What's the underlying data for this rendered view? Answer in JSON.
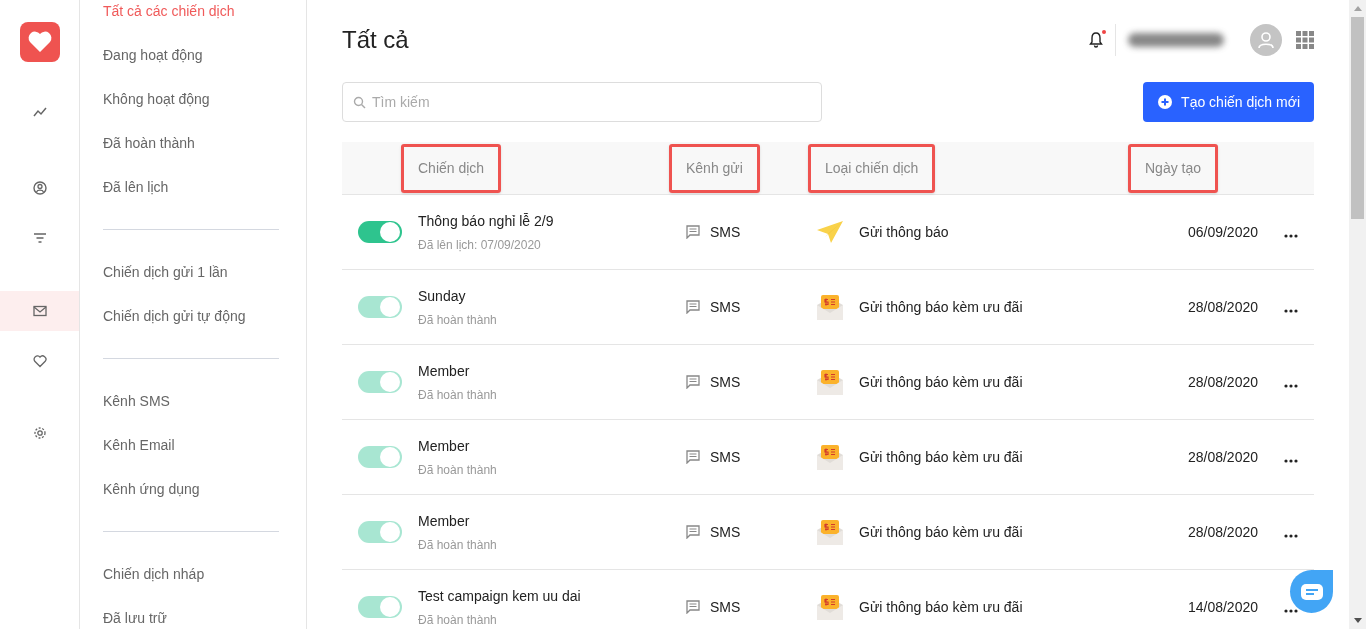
{
  "rail": {
    "items": [
      {
        "kind": "chart",
        "selected": false
      },
      {
        "kind": "user",
        "selected": false
      },
      {
        "kind": "filter",
        "selected": false
      },
      {
        "kind": "mail",
        "selected": true
      },
      {
        "kind": "heart",
        "selected": false
      },
      {
        "kind": "settings",
        "selected": false
      }
    ]
  },
  "sidebar": {
    "groups": [
      [
        {
          "label": "Tất cả các chiến dịch",
          "selected": true
        },
        {
          "label": "Đang hoạt động",
          "selected": false
        },
        {
          "label": "Không hoạt động",
          "selected": false
        },
        {
          "label": "Đã hoàn thành",
          "selected": false
        },
        {
          "label": "Đã lên lịch",
          "selected": false
        }
      ],
      [
        {
          "label": "Chiến dịch gửi 1 lần",
          "selected": false
        },
        {
          "label": "Chiến dịch gửi tự động",
          "selected": false
        }
      ],
      [
        {
          "label": "Kênh SMS",
          "selected": false
        },
        {
          "label": "Kênh Email",
          "selected": false
        },
        {
          "label": "Kênh ứng dụng",
          "selected": false
        }
      ],
      [
        {
          "label": "Chiến dịch nháp",
          "selected": false
        },
        {
          "label": "Đã lưu trữ",
          "selected": false
        }
      ]
    ]
  },
  "header": {
    "title": "Tất cả",
    "notification_dot": true
  },
  "search": {
    "placeholder": "Tìm kiếm"
  },
  "create_button": "Tạo chiến dịch mới",
  "table": {
    "columns": [
      {
        "label": "Chiến dịch",
        "highlighted": true
      },
      {
        "label": "Kênh gửi",
        "highlighted": true
      },
      {
        "label": "Loại chiến dịch",
        "highlighted": true
      },
      {
        "label": "Ngày tạo",
        "highlighted": true
      }
    ],
    "rows": [
      {
        "on": true,
        "disabled": false,
        "name": "Thông báo nghỉ lễ 2/9",
        "status": "Đã lên lịch: 07/09/2020",
        "channel": "SMS",
        "kind": "notice",
        "type": "Gửi thông báo",
        "date": "06/09/2020"
      },
      {
        "on": true,
        "disabled": true,
        "name": "Sunday",
        "status": "Đã hoàn thành",
        "channel": "SMS",
        "kind": "offer",
        "type": "Gửi thông báo kèm ưu đãi",
        "date": "28/08/2020"
      },
      {
        "on": true,
        "disabled": true,
        "name": "Member",
        "status": "Đã hoàn thành",
        "channel": "SMS",
        "kind": "offer",
        "type": "Gửi thông báo kèm ưu đãi",
        "date": "28/08/2020"
      },
      {
        "on": true,
        "disabled": true,
        "name": "Member",
        "status": "Đã hoàn thành",
        "channel": "SMS",
        "kind": "offer",
        "type": "Gửi thông báo kèm ưu đãi",
        "date": "28/08/2020"
      },
      {
        "on": true,
        "disabled": true,
        "name": "Member",
        "status": "Đã hoàn thành",
        "channel": "SMS",
        "kind": "offer",
        "type": "Gửi thông báo kèm ưu đãi",
        "date": "28/08/2020"
      },
      {
        "on": true,
        "disabled": true,
        "name": "Test campaign kem uu dai",
        "status": "Đã hoàn thành",
        "channel": "SMS",
        "kind": "offer",
        "type": "Gửi thông báo kèm ưu đãi",
        "date": "14/08/2020"
      }
    ]
  }
}
